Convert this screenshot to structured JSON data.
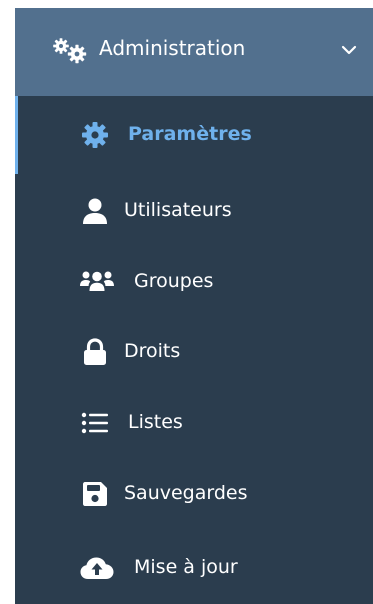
{
  "menu": {
    "header": {
      "label": "Administration",
      "icon": "cogs-icon",
      "chevron_icon": "chevron-down-icon"
    },
    "items": [
      {
        "label": "Paramètres",
        "icon": "gear-icon",
        "active": true
      },
      {
        "label": "Utilisateurs",
        "icon": "user-icon",
        "active": false
      },
      {
        "label": "Groupes",
        "icon": "users-icon",
        "active": false
      },
      {
        "label": "Droits",
        "icon": "lock-icon",
        "active": false
      },
      {
        "label": "Listes",
        "icon": "list-icon",
        "active": false
      },
      {
        "label": "Sauvegardes",
        "icon": "save-icon",
        "active": false
      },
      {
        "label": "Mise à jour",
        "icon": "cloud-upload-icon",
        "active": false
      }
    ]
  },
  "colors": {
    "menu_bg": "#2b3d4e",
    "header_bg": "#52708e",
    "active_text": "#6fb1ec",
    "text": "#ffffff"
  }
}
